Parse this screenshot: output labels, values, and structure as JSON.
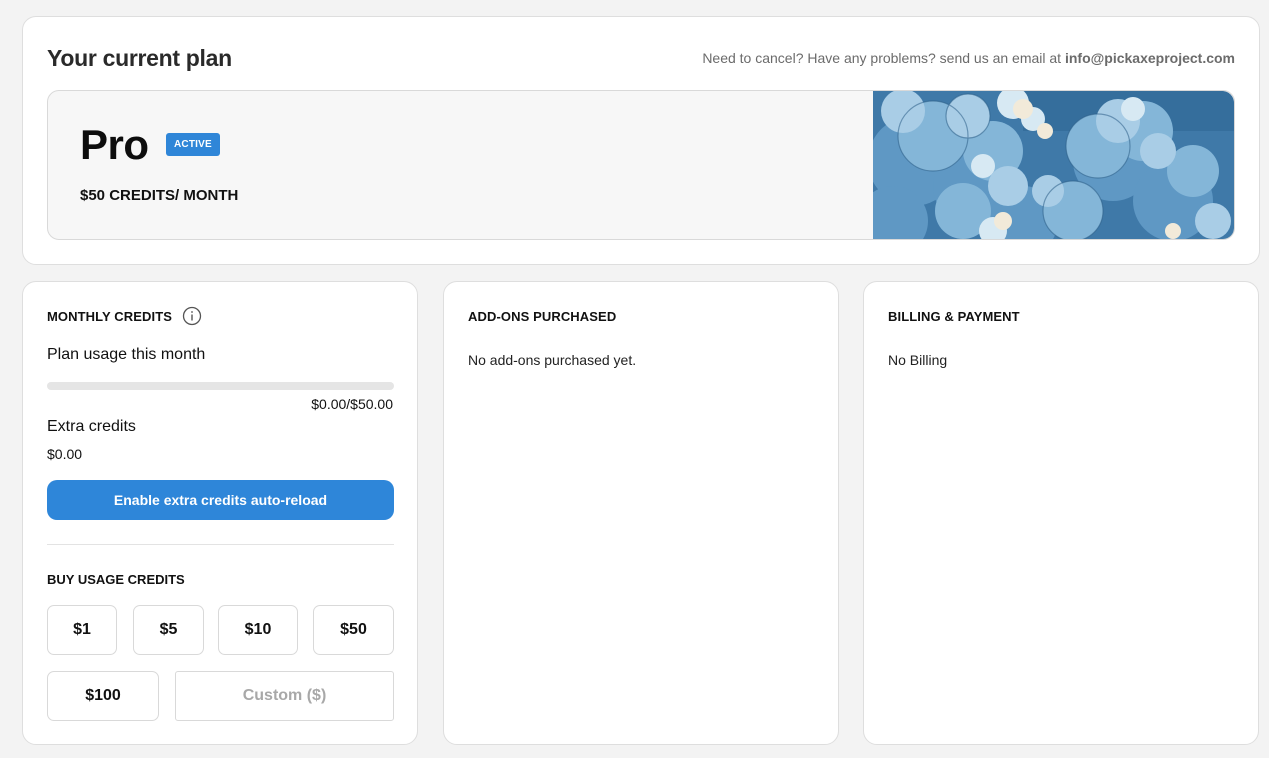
{
  "plan": {
    "heading": "Your current plan",
    "contact_text": "Need to cancel? Have any problems? send us an email at",
    "contact_email": "info@pickaxeproject.com",
    "name": "Pro",
    "status_badge": "ACTIVE",
    "price": "$50 CREDITS/ MONTH"
  },
  "monthly_credits": {
    "title": "MONTHLY CREDITS",
    "info_icon": "info-icon",
    "usage_label": "Plan usage this month",
    "usage_progress": 0,
    "usage_amount": "$0.00/$50.00",
    "extra_label": "Extra credits",
    "extra_value": "$0.00",
    "reload_button": "Enable extra credits auto-reload",
    "buy_title": "BUY USAGE CREDITS",
    "amounts": [
      "$1",
      "$5",
      "$10",
      "$50",
      "$100"
    ],
    "custom_placeholder": "Custom ($)"
  },
  "addons": {
    "title": "ADD-ONS PURCHASED",
    "empty_text": "No add-ons purchased yet."
  },
  "billing": {
    "title": "BILLING & PAYMENT",
    "empty_text": "No Billing"
  },
  "colors": {
    "accent": "#2e86d9",
    "background": "#f3f3f3"
  }
}
